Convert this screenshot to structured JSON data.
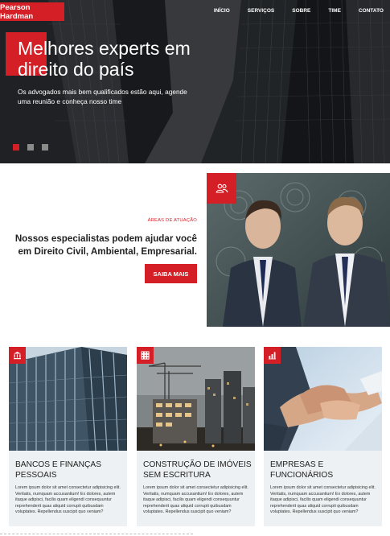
{
  "brand": {
    "name": "Pearson Hardman"
  },
  "nav": {
    "items": [
      "INÍCIO",
      "SERVIÇOS",
      "SOBRE",
      "TIME",
      "CONTATO"
    ]
  },
  "hero": {
    "title": "Melhores experts em direito do país",
    "subtitle": "Os advogados mais bem qualificados estão aqui, agende uma reunião e conheça nosso time",
    "slides": 3,
    "active_slide": 1
  },
  "areas": {
    "label": "ÁREAS DE ATUAÇÃO",
    "heading": "Nossos especialistas podem ajudar você em Direito Civil, Ambiental, Empresarial.",
    "button": "SAIBA MAIS",
    "badge_icon": "people-icon"
  },
  "cards": [
    {
      "title": "BANCOS E FINANÇAS PESSOAIS",
      "icon": "bank-icon",
      "text": "Lorem ipsum dolor sit amet consectetur adipisicing elit. Veritatis, numquam accusantium! Ex dolores, autem itaque adipisci, facilis quam eligendi consequuntur reprehenderit quas aliquid corrupti quibusdam voluptates. Repellendus suscipit quo veniam?"
    },
    {
      "title": "CONSTRUÇÃO DE IMÓVEIS SEM ESCRITURA",
      "icon": "grid-building-icon",
      "text": "Lorem ipsum dolor sit amet consectetur adipisicing elit. Veritatis, numquam accusantium! Ex dolores, autem itaque adipisci, facilis quam eligendi consequuntur reprehenderit quas aliquid corrupti quibusdam voluptates. Repellendus suscipit quo veniam?"
    },
    {
      "title": "EMPRESAS E FUNCIONÁRIOS",
      "icon": "bar-chart-icon",
      "text": "Lorem ipsum dolor sit amet consectetur adipisicing elit. Veritatis, numquam accusantium! Ex dolores, autem itaque adipisci, facilis quam eligendi consequuntur reprehenderit quas aliquid corrupti quibusdam voluptates. Repellendus suscipit quo veniam?"
    }
  ],
  "colors": {
    "accent": "#d51f26",
    "card_bg": "#eef1f3",
    "text": "#222222"
  }
}
